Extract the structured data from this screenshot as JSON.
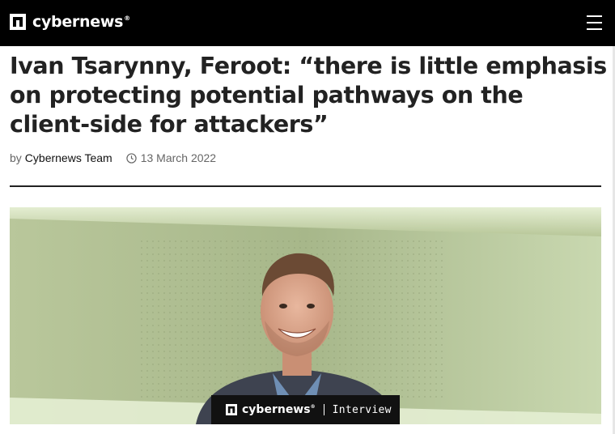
{
  "header": {
    "logo_text": "cybernews",
    "logo_reg": "®",
    "menu_icon": "hamburger-menu-icon"
  },
  "article": {
    "title": "Ivan Tsarynny, Feroot: “there is little emphasis on protecting potential pathways on the client-side for attackers”",
    "byline_prefix": "by",
    "author": "Cybernews Team",
    "date": "13 March 2022",
    "date_icon": "clock-icon"
  },
  "hero": {
    "caption_logo_text": "cybernews",
    "caption_reg": "®",
    "caption_label": "Interview",
    "background_color": "#a9b98c"
  },
  "colors": {
    "header_bg": "#000000",
    "text": "#222222",
    "meta_text": "#666666"
  }
}
